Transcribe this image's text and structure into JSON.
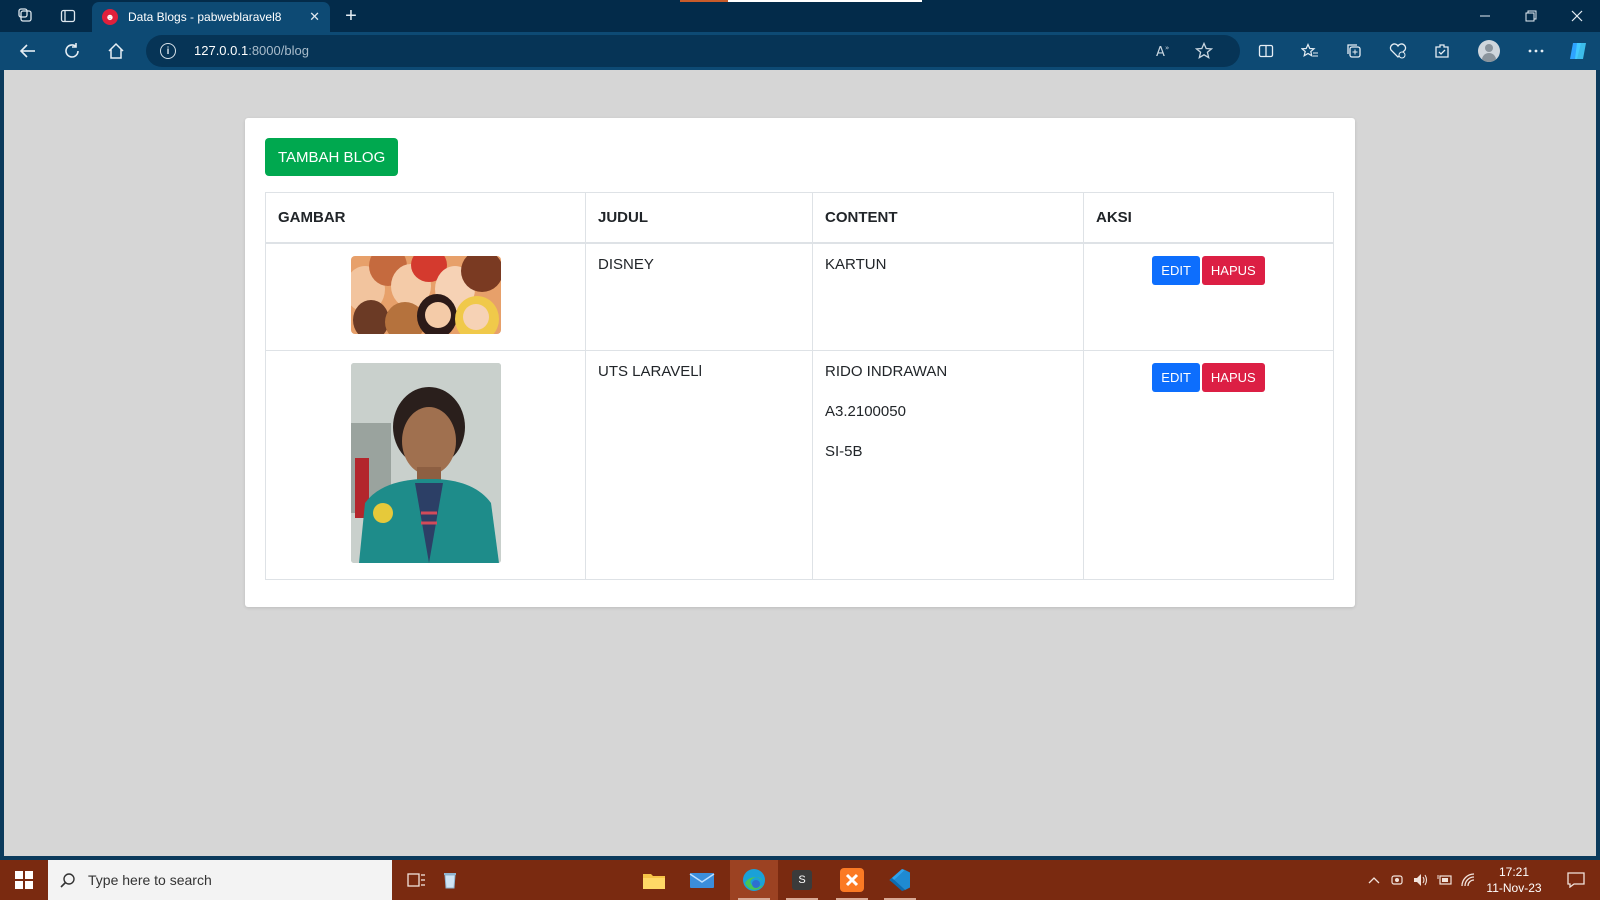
{
  "browser": {
    "tab_title": "Data Blogs - pabweblaravel8",
    "url_host": "127.0.0.1",
    "url_rest": ":8000/blog",
    "new_tab": "+",
    "close_tab": "✕"
  },
  "page": {
    "add_button": "TAMBAH BLOG",
    "columns": [
      "GAMBAR",
      "JUDUL",
      "CONTENT",
      "AKSI"
    ],
    "rows": [
      {
        "judul": "DISNEY",
        "content": [
          "KARTUN"
        ],
        "edit": "EDIT",
        "delete": "HAPUS"
      },
      {
        "judul": "UTS LARAVELl",
        "content": [
          "RIDO INDRAWAN",
          "A3.2100050",
          "SI-5B"
        ],
        "edit": "EDIT",
        "delete": "HAPUS"
      }
    ]
  },
  "taskbar": {
    "search_placeholder": "Type here to search",
    "time": "17:21",
    "date": "11-Nov-23"
  },
  "colors": {
    "add_button": "#00a84f",
    "edit_button": "#0d6efd",
    "delete_button": "#dc1f44",
    "page_bg": "#d6d6d6",
    "taskbar": "#7a2a10"
  }
}
